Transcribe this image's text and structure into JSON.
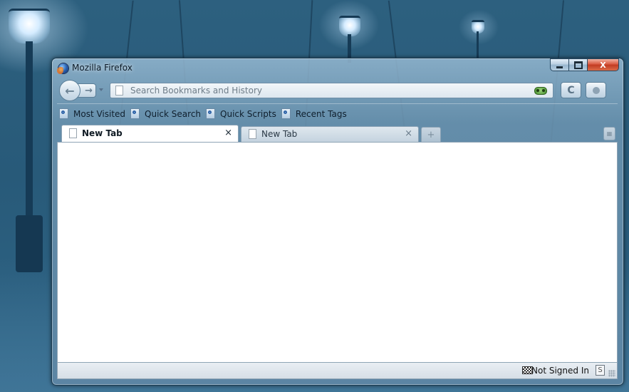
{
  "window": {
    "title": "Mozilla Firefox",
    "controls": {
      "minimize_icon": "minimize-icon",
      "maximize_icon": "maximize-icon",
      "close_label": "X"
    }
  },
  "navbar": {
    "back_glyph": "←",
    "forward_glyph": "→",
    "url": {
      "value": "",
      "placeholder": "Search Bookmarks and History"
    },
    "reload_glyph": "C"
  },
  "bookmarks": {
    "items": [
      {
        "label": "Most Visited"
      },
      {
        "label": "Quick Search"
      },
      {
        "label": "Quick Scripts"
      },
      {
        "label": "Recent Tags"
      }
    ]
  },
  "tabs": {
    "items": [
      {
        "label": "New Tab",
        "active": true,
        "close": "×"
      },
      {
        "label": "New Tab",
        "active": false,
        "close": "×"
      }
    ],
    "new_tab_glyph": "+",
    "all_tabs_glyph": "▦"
  },
  "statusbar": {
    "sync_status": "Not Signed In",
    "s_icon_letter": "S"
  },
  "colors": {
    "desktop": "#2b5f7f",
    "window_frame": "#6f96b4",
    "close_button": "#c23b22"
  }
}
